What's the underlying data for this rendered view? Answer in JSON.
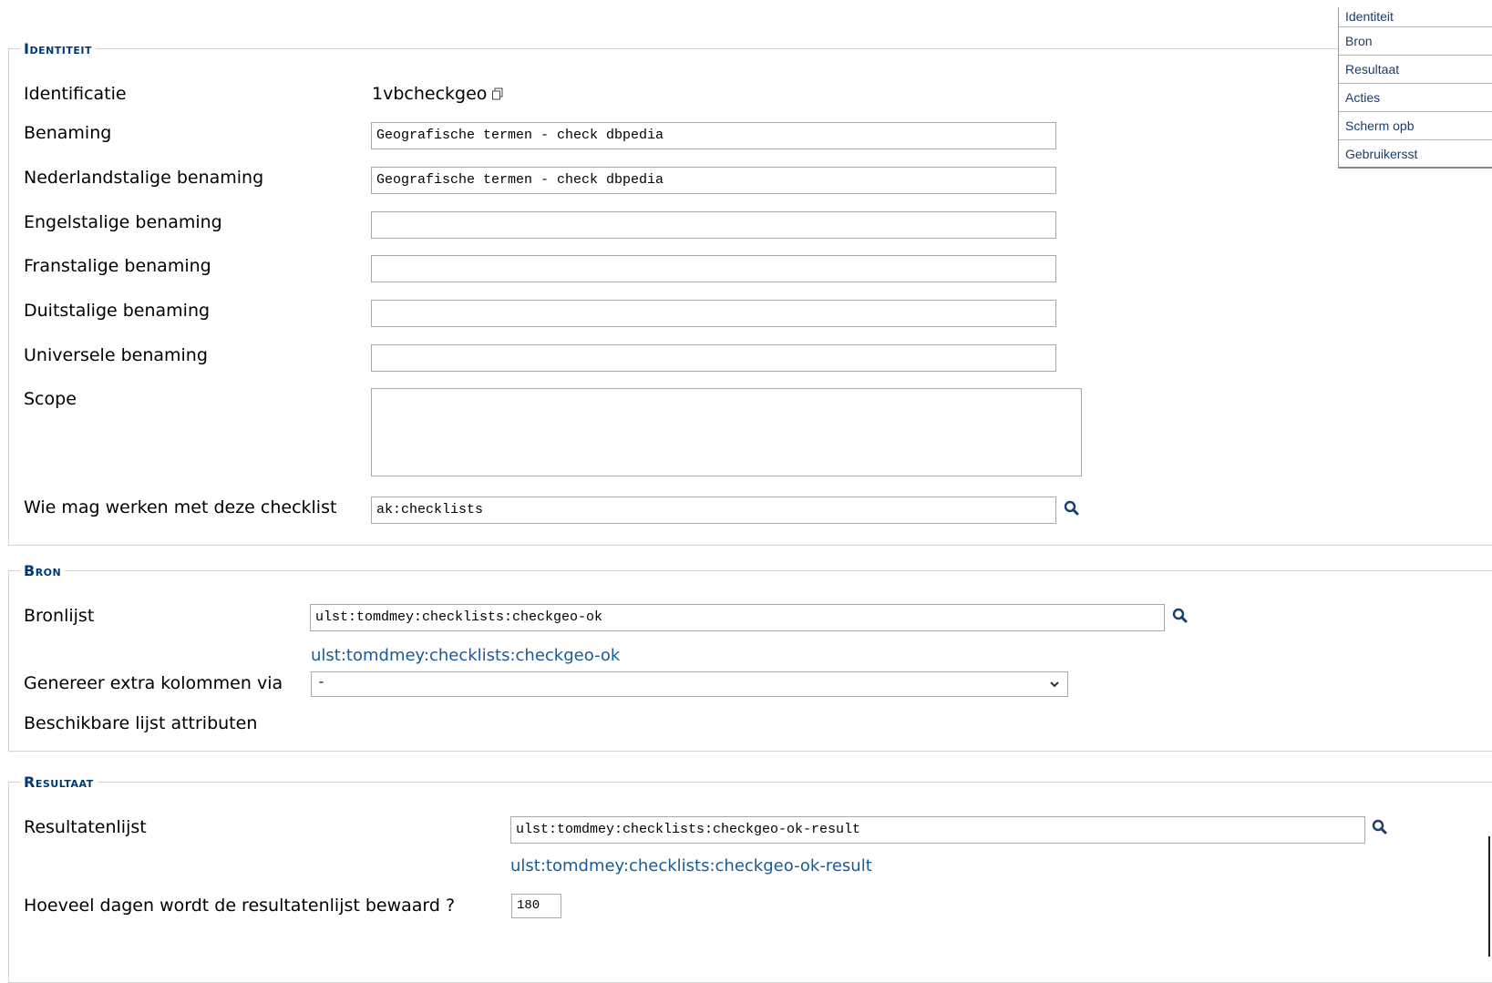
{
  "nav": {
    "items": [
      {
        "label": "Identiteit"
      },
      {
        "label": "Bron"
      },
      {
        "label": "Resultaat"
      },
      {
        "label": "Acties"
      },
      {
        "label": "Scherm opb"
      },
      {
        "label": "Gebruikersst"
      }
    ]
  },
  "identiteit": {
    "legend": "Identiteit",
    "identificatie_label": "Identificatie",
    "identificatie_value": "1vbcheckgeo",
    "benaming_label": "Benaming",
    "benaming_value": "Geografische termen - check dbpedia",
    "nl_label": "Nederlandstalige benaming",
    "nl_value": "Geografische termen - check dbpedia",
    "en_label": "Engelstalige benaming",
    "en_value": "",
    "fr_label": "Franstalige benaming",
    "fr_value": "",
    "de_label": "Duitstalige benaming",
    "de_value": "",
    "uni_label": "Universele benaming",
    "uni_value": "",
    "scope_label": "Scope",
    "scope_value": "",
    "wie_label": "Wie mag werken met deze checklist",
    "wie_value": "ak:checklists"
  },
  "bron": {
    "legend": "Bron",
    "bronlijst_label": "Bronlijst",
    "bronlijst_value": "ulst:tomdmey:checklists:checkgeo-ok",
    "bronlijst_link": "ulst:tomdmey:checklists:checkgeo-ok",
    "genereer_label": "Genereer extra kolommen via",
    "genereer_value": "-",
    "attrib_label": "Beschikbare lijst attributen"
  },
  "resultaat": {
    "legend": "Resultaat",
    "lijst_label": "Resultatenlijst",
    "lijst_value": "ulst:tomdmey:checklists:checkgeo-ok-result",
    "lijst_link": "ulst:tomdmey:checklists:checkgeo-ok-result",
    "dagen_label": "Hoeveel dagen wordt de resultatenlijst bewaard ?",
    "dagen_value": "180"
  },
  "colors": {
    "legend": "#003873",
    "link": "#1a5a96",
    "border": "#a9a9a9"
  },
  "icons": [
    "copy-icon",
    "search-icon",
    "chevron-down-icon",
    "resize-grip-icon"
  ]
}
